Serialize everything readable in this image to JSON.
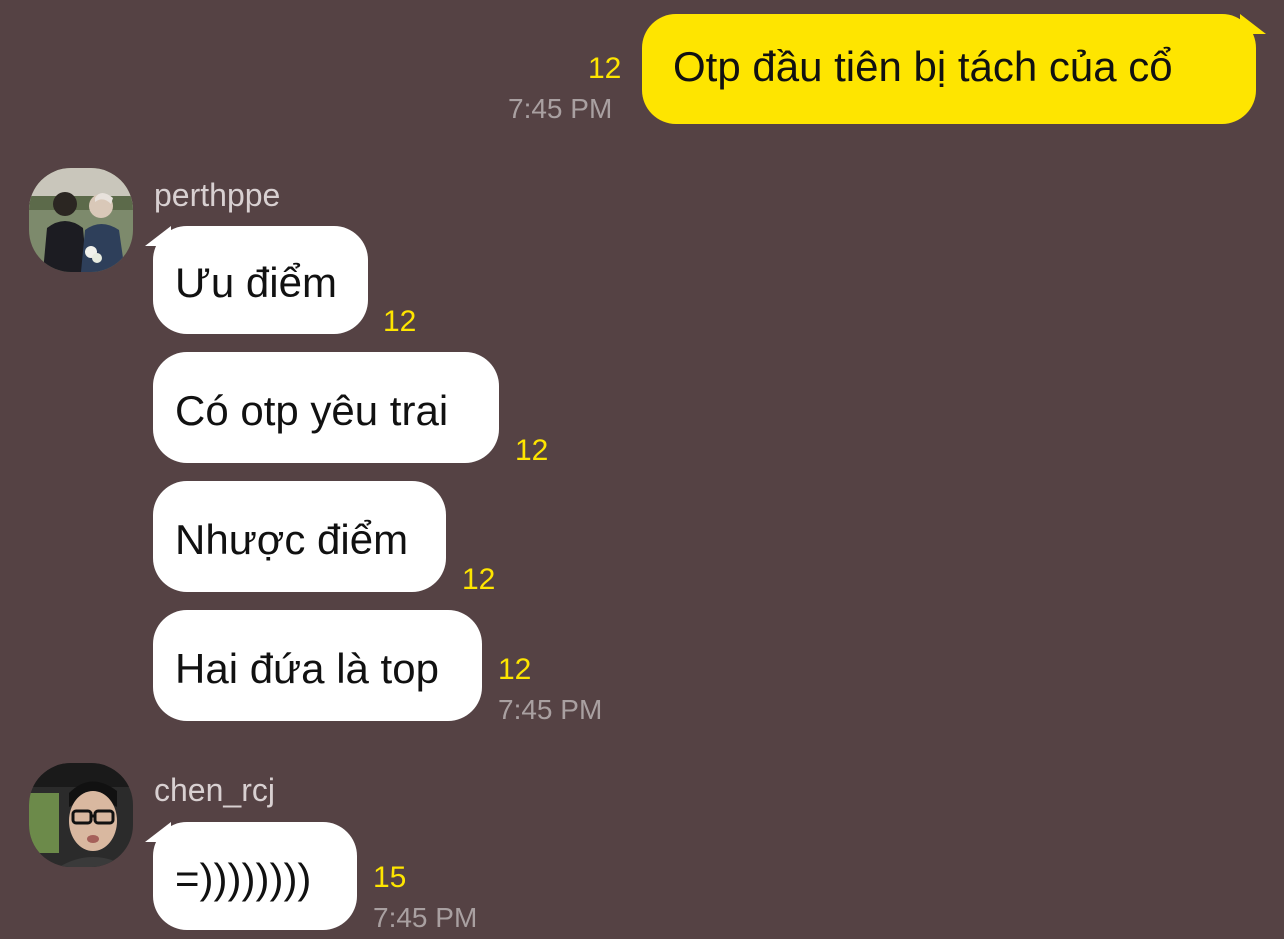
{
  "colors": {
    "background": "#554244",
    "my_bubble": "#fee500",
    "their_bubble": "#ffffff",
    "unread_count": "#fee500",
    "timestamp": "#a9a0a1"
  },
  "messages": [
    {
      "sender": "me",
      "text": "Otp đầu tiên bị tách của cổ",
      "unread": "12",
      "time": "7:45 PM"
    }
  ],
  "groups": [
    {
      "sender": "perthppe",
      "avatar_icon": "profile-photo-icon",
      "messages": [
        {
          "text": "Ưu điểm",
          "unread": "12",
          "time": ""
        },
        {
          "text": "Có otp yêu trai",
          "unread": "12",
          "time": ""
        },
        {
          "text": "Nhược điểm",
          "unread": "12",
          "time": ""
        },
        {
          "text": "Hai đứa là top",
          "unread": "12",
          "time": "7:45 PM"
        }
      ]
    },
    {
      "sender": "chen_rcj",
      "avatar_icon": "profile-photo-icon",
      "messages": [
        {
          "text": "=))))))))",
          "unread": "15",
          "time": "7:45 PM"
        }
      ]
    }
  ]
}
